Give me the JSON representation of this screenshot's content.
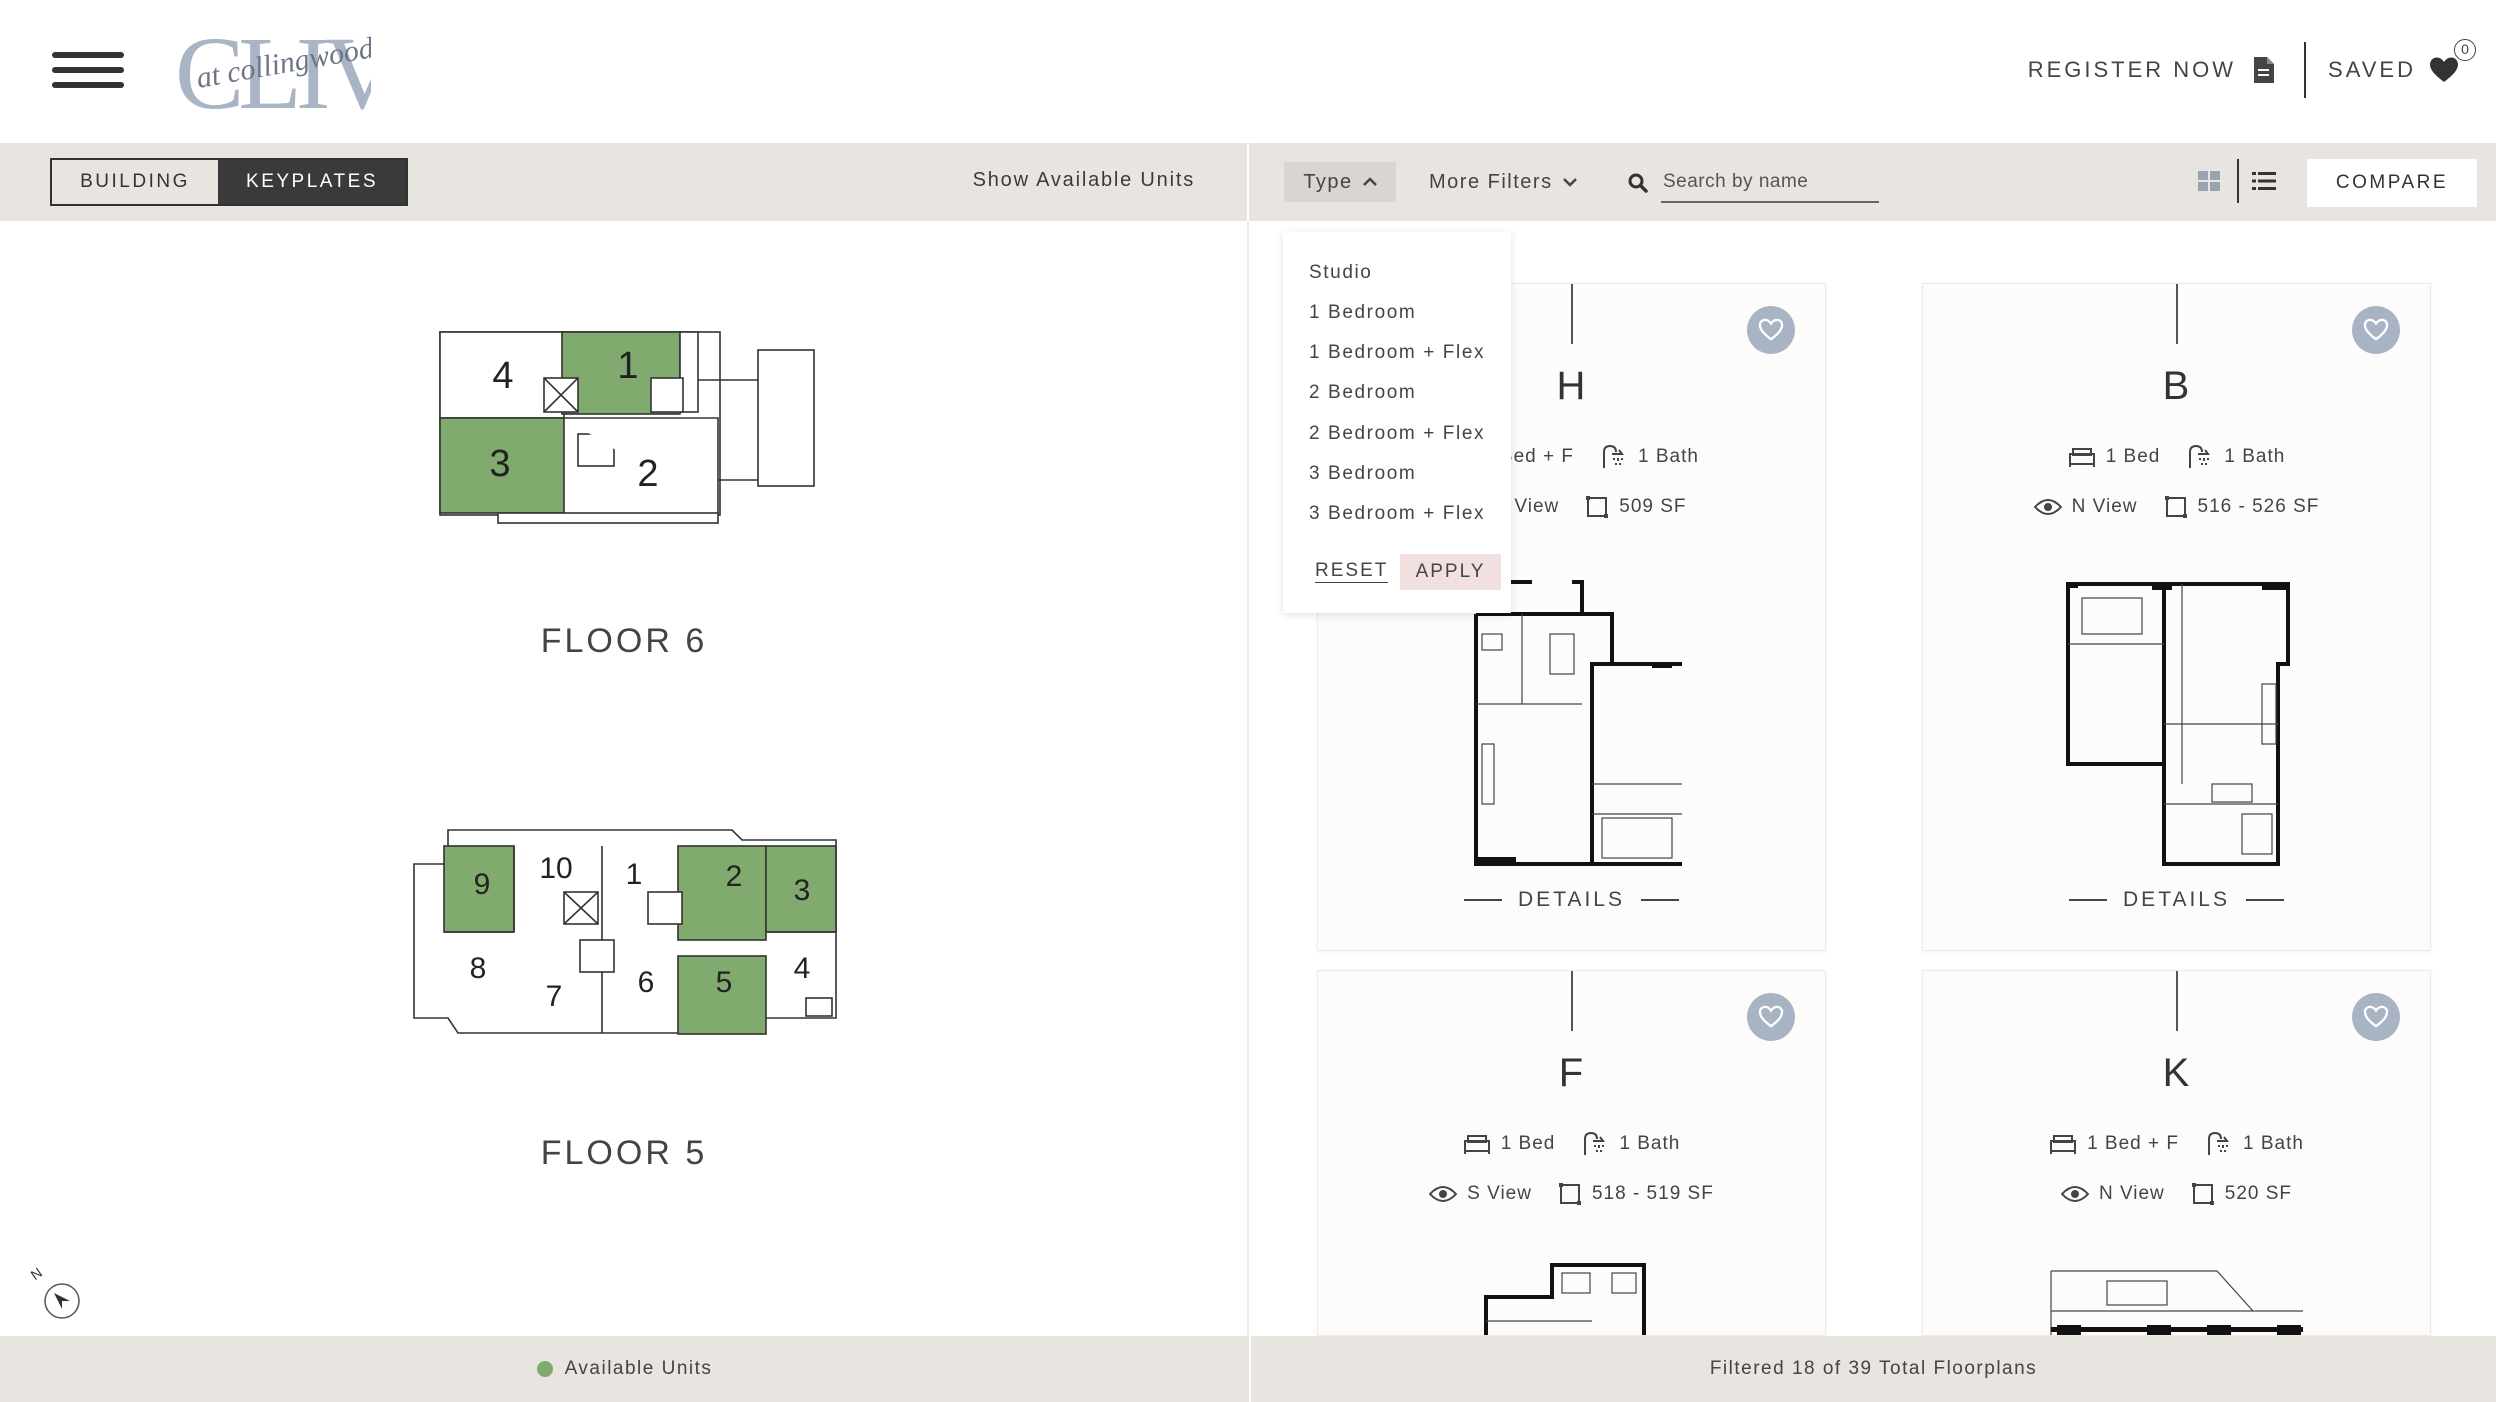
{
  "header": {
    "logo_text_main": "CLIVE",
    "logo_text_script": "at collingwood",
    "register_label": "REGISTER NOW",
    "saved_label": "SAVED",
    "saved_count": "0"
  },
  "left_toolbar": {
    "building_label": "BUILDING",
    "keyplates_label": "KEYPLATES",
    "active_tab": "KEYPLATES",
    "show_available_label": "Show Available Units"
  },
  "right_toolbar": {
    "type_label": "Type",
    "more_filters_label": "More Filters",
    "search_placeholder": "Search by name",
    "compare_label": "COMPARE"
  },
  "type_dropdown": {
    "options": [
      "Studio",
      "1 Bedroom",
      "1 Bedroom + Flex",
      "2 Bedroom",
      "2 Bedroom + Flex",
      "3 Bedroom",
      "3 Bedroom + Flex"
    ],
    "reset_label": "RESET",
    "apply_label": "APPLY"
  },
  "keyplates": [
    {
      "floor_label": "FLOOR 6",
      "units": [
        "4",
        "1",
        "3",
        "2"
      ],
      "available_units": [
        "1",
        "3"
      ]
    },
    {
      "floor_label": "FLOOR 5",
      "units": [
        "9",
        "10",
        "1",
        "2",
        "3",
        "8",
        "7",
        "6",
        "5",
        "4"
      ],
      "available_units": [
        "9",
        "2",
        "3",
        "5"
      ]
    }
  ],
  "cards": [
    {
      "name": "H",
      "bed": "1 Bed + F",
      "bath": "1 Bath",
      "view": "S View",
      "size": "509 SF",
      "details_label": "DETAILS"
    },
    {
      "name": "B",
      "bed": "1 Bed",
      "bath": "1 Bath",
      "view": "N View",
      "size": "516 - 526 SF",
      "details_label": "DETAILS"
    },
    {
      "name": "F",
      "bed": "1 Bed",
      "bath": "1 Bath",
      "view": "S View",
      "size": "518 - 519 SF",
      "details_label": "DETAILS"
    },
    {
      "name": "K",
      "bed": "1 Bed + F",
      "bath": "1 Bath",
      "view": "N View",
      "size": "520 SF",
      "details_label": "DETAILS"
    }
  ],
  "footer": {
    "legend_label": "Available Units",
    "filter_summary": "Filtered 18 of 39 Total Floorplans"
  },
  "colors": {
    "available_green": "#80aa6e",
    "toolbar_bg": "#e8e4df",
    "heart_bg": "#a8b3c4",
    "apply_bg": "#f2dfe0",
    "logo_color": "#a9b4c4"
  }
}
